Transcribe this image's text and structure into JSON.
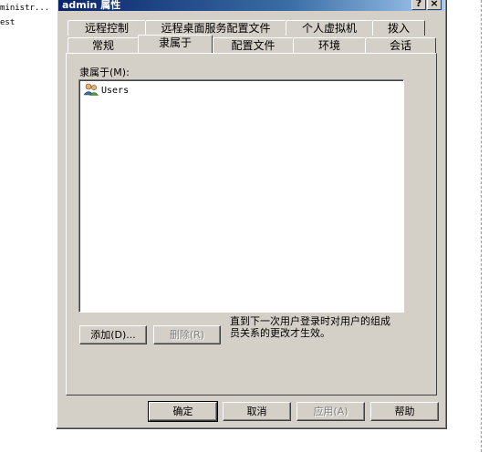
{
  "background": {
    "line1": "ministr...",
    "line2": "est"
  },
  "dialog": {
    "title": "admin 属性",
    "help_glyph": "?",
    "close_glyph": "×"
  },
  "tabs": {
    "row1": [
      "远程控制",
      "远程桌面服务配置文件",
      "个人虚拟机",
      "拨入"
    ],
    "row2": [
      "常规",
      "隶属于",
      "配置文件",
      "环境",
      "会话"
    ],
    "selected": "隶属于"
  },
  "member_of": {
    "label": "隶属于(M):",
    "items": [
      {
        "name": "Users",
        "icon": "users-group-icon"
      }
    ],
    "add_label": "添加(D)...",
    "remove_label": "删除(R)",
    "note": "直到下一次用户登录时对用户的组成员关系的更改才生效。"
  },
  "footer": {
    "ok_label": "确定",
    "cancel_label": "取消",
    "apply_label": "应用(A)",
    "help_label": "帮助"
  }
}
